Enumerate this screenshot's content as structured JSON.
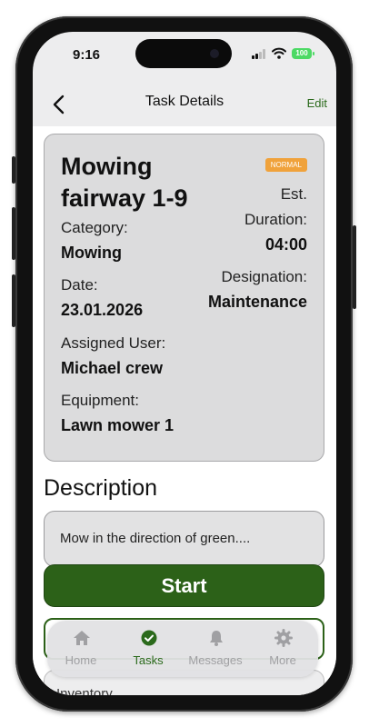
{
  "status_bar": {
    "time": "9:16",
    "battery": "100"
  },
  "navbar": {
    "title": "Task Details",
    "edit_label": "Edit"
  },
  "task": {
    "title": "Mowing fairway 1-9",
    "priority_badge": "NORMAL",
    "category_label": "Category:",
    "category_value": "Mowing",
    "date_label": "Date:",
    "date_value": "23.01.2026",
    "assigned_label": "Assigned User:",
    "assigned_value": "Michael crew",
    "equipment_label": "Equipment:",
    "equipment_value": "Lawn mower 1",
    "duration_label_1": "Est.",
    "duration_label_2": "Duration:",
    "duration_value": "04:00",
    "designation_label": "Designation:",
    "designation_value": "Maintenance"
  },
  "description": {
    "heading": "Description",
    "text": "Mow in the direction of green...."
  },
  "start_button": "Start",
  "inventory_label": "Inventory",
  "tabbar": {
    "tabs": [
      {
        "label": "Home",
        "icon": "home-icon"
      },
      {
        "label": "Tasks",
        "icon": "check-circle-icon",
        "active": true
      },
      {
        "label": "Messages",
        "icon": "bell-icon"
      },
      {
        "label": "More",
        "icon": "gear-icon"
      }
    ]
  },
  "colors": {
    "accent": "#2c6118",
    "badge": "#f0a23b",
    "battery": "#4cd964"
  }
}
